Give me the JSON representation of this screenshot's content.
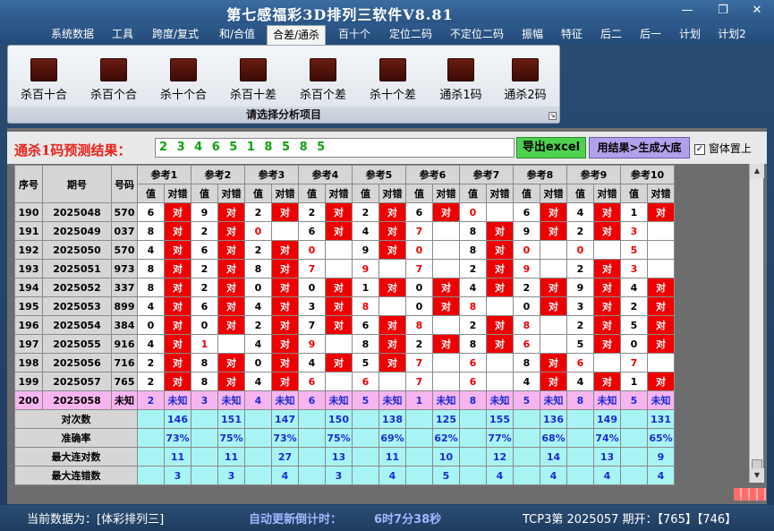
{
  "window": {
    "title": "第七感福彩3D排列三软件V8.81",
    "controls": [
      "minimize-icon",
      "restore-icon",
      "close-icon"
    ]
  },
  "menu": [
    "系统数据",
    "工具",
    "跨度/复式",
    "和/合值",
    "合差/通杀",
    "百十个",
    "定位二码",
    "不定位二码",
    "振幅",
    "特征",
    "后二",
    "后一",
    "计划",
    "计划2"
  ],
  "active_menu": "合差/通杀",
  "ribbon": {
    "buttons": [
      "杀百十合",
      "杀百个合",
      "杀十个合",
      "杀百十差",
      "杀百个差",
      "杀十个差",
      "通杀1码",
      "通杀2码"
    ],
    "footer": "请选择分析项目"
  },
  "prediction": {
    "label": "通杀1码预测结果：",
    "value": "2 3 4 6 5 1 8 5 8 5",
    "excel_button": "导出excel",
    "generate_button": "用结果>生成大底",
    "topmost_label": "窗体置上",
    "topmost_checked": true
  },
  "table": {
    "headers": {
      "index": "序号",
      "period": "期号",
      "number": "号码",
      "refs": [
        "参考1",
        "参考2",
        "参考3",
        "参考4",
        "参考5",
        "参考6",
        "参考7",
        "参考8",
        "参考9",
        "参考10"
      ],
      "sub": [
        "值",
        "对错"
      ]
    },
    "rows": [
      {
        "idx": "190",
        "period": "2025048",
        "num": "570",
        "cells": [
          [
            "6",
            1
          ],
          [
            "9",
            1
          ],
          [
            "2",
            1
          ],
          [
            "2",
            1
          ],
          [
            "2",
            1
          ],
          [
            "6",
            1
          ],
          [
            "0",
            0
          ],
          [
            "6",
            1
          ],
          [
            "4",
            1
          ],
          [
            "1",
            1
          ]
        ]
      },
      {
        "idx": "191",
        "period": "2025049",
        "num": "037",
        "cells": [
          [
            "8",
            1
          ],
          [
            "2",
            1
          ],
          [
            "0",
            0
          ],
          [
            "6",
            1
          ],
          [
            "4",
            1
          ],
          [
            "7",
            0
          ],
          [
            "8",
            1
          ],
          [
            "9",
            1
          ],
          [
            "2",
            1
          ],
          [
            "3",
            0
          ]
        ]
      },
      {
        "idx": "192",
        "period": "2025050",
        "num": "570",
        "cells": [
          [
            "4",
            1
          ],
          [
            "6",
            1
          ],
          [
            "2",
            1
          ],
          [
            "0",
            0
          ],
          [
            "9",
            1
          ],
          [
            "0",
            0
          ],
          [
            "8",
            1
          ],
          [
            "0",
            0
          ],
          [
            "0",
            0
          ],
          [
            "5",
            0
          ]
        ]
      },
      {
        "idx": "193",
        "period": "2025051",
        "num": "973",
        "cells": [
          [
            "8",
            1
          ],
          [
            "2",
            1
          ],
          [
            "8",
            1
          ],
          [
            "7",
            0
          ],
          [
            "9",
            0
          ],
          [
            "7",
            0
          ],
          [
            "2",
            1
          ],
          [
            "9",
            0
          ],
          [
            "2",
            1
          ],
          [
            "3",
            0
          ]
        ]
      },
      {
        "idx": "194",
        "period": "2025052",
        "num": "337",
        "cells": [
          [
            "8",
            1
          ],
          [
            "2",
            1
          ],
          [
            "0",
            1
          ],
          [
            "0",
            1
          ],
          [
            "1",
            1
          ],
          [
            "0",
            1
          ],
          [
            "4",
            1
          ],
          [
            "2",
            1
          ],
          [
            "9",
            1
          ],
          [
            "4",
            1
          ]
        ]
      },
      {
        "idx": "195",
        "period": "2025053",
        "num": "899",
        "cells": [
          [
            "4",
            1
          ],
          [
            "6",
            1
          ],
          [
            "4",
            1
          ],
          [
            "3",
            1
          ],
          [
            "8",
            0
          ],
          [
            "0",
            1
          ],
          [
            "8",
            0
          ],
          [
            "0",
            1
          ],
          [
            "3",
            1
          ],
          [
            "2",
            1
          ]
        ]
      },
      {
        "idx": "196",
        "period": "2025054",
        "num": "384",
        "cells": [
          [
            "0",
            1
          ],
          [
            "0",
            1
          ],
          [
            "2",
            1
          ],
          [
            "7",
            1
          ],
          [
            "6",
            1
          ],
          [
            "8",
            0
          ],
          [
            "2",
            1
          ],
          [
            "8",
            0
          ],
          [
            "2",
            1
          ],
          [
            "5",
            1
          ]
        ]
      },
      {
        "idx": "197",
        "period": "2025055",
        "num": "916",
        "cells": [
          [
            "4",
            1
          ],
          [
            "1",
            0
          ],
          [
            "4",
            1
          ],
          [
            "9",
            0
          ],
          [
            "8",
            1
          ],
          [
            "2",
            1
          ],
          [
            "8",
            1
          ],
          [
            "6",
            0
          ],
          [
            "5",
            1
          ],
          [
            "0",
            1
          ]
        ]
      },
      {
        "idx": "198",
        "period": "2025056",
        "num": "716",
        "cells": [
          [
            "2",
            1
          ],
          [
            "8",
            1
          ],
          [
            "0",
            1
          ],
          [
            "4",
            1
          ],
          [
            "5",
            1
          ],
          [
            "7",
            0
          ],
          [
            "6",
            0
          ],
          [
            "8",
            1
          ],
          [
            "6",
            0
          ],
          [
            "7",
            0
          ]
        ]
      },
      {
        "idx": "199",
        "period": "2025057",
        "num": "765",
        "cells": [
          [
            "2",
            1
          ],
          [
            "8",
            1
          ],
          [
            "4",
            1
          ],
          [
            "6",
            0
          ],
          [
            "6",
            0
          ],
          [
            "7",
            0
          ],
          [
            "6",
            0
          ],
          [
            "4",
            1
          ],
          [
            "4",
            1
          ],
          [
            "1",
            1
          ]
        ]
      }
    ],
    "correct_text": "对",
    "unknown_row": {
      "idx": "200",
      "period": "2025058",
      "num": "未知",
      "values": [
        "2",
        "3",
        "4",
        "6",
        "5",
        "1",
        "8",
        "5",
        "8",
        "5"
      ],
      "unknown_text": "未知"
    },
    "stats": [
      {
        "label": "对次数",
        "values": [
          "146",
          "151",
          "147",
          "150",
          "138",
          "125",
          "155",
          "136",
          "149",
          "131"
        ]
      },
      {
        "label": "准确率",
        "values": [
          "73%",
          "75%",
          "73%",
          "75%",
          "69%",
          "62%",
          "77%",
          "68%",
          "74%",
          "65%"
        ]
      },
      {
        "label": "最大连对数",
        "values": [
          "11",
          "11",
          "27",
          "13",
          "11",
          "10",
          "12",
          "14",
          "13",
          "9"
        ]
      },
      {
        "label": "最大连错数",
        "values": [
          "3",
          "3",
          "4",
          "3",
          "4",
          "5",
          "4",
          "4",
          "4",
          "4"
        ]
      }
    ]
  },
  "status": {
    "data_label": "当前数据为：[体彩排列三]",
    "countdown_label": "自动更新倒计时：",
    "countdown_value": "6时7分38秒",
    "latest": "TCP3第 2025057 期开：【765】【746】"
  },
  "colors": {
    "correct": "#ee0000",
    "unknown_row": "#f7b5f0",
    "stats_row": "#a8f4f4",
    "stat_text": "#1a2ad8",
    "excel_button": "#4ed14e",
    "generate_button": "#b2a0ec",
    "prediction_label": "#e8231b",
    "prediction_value": "#11a011"
  }
}
